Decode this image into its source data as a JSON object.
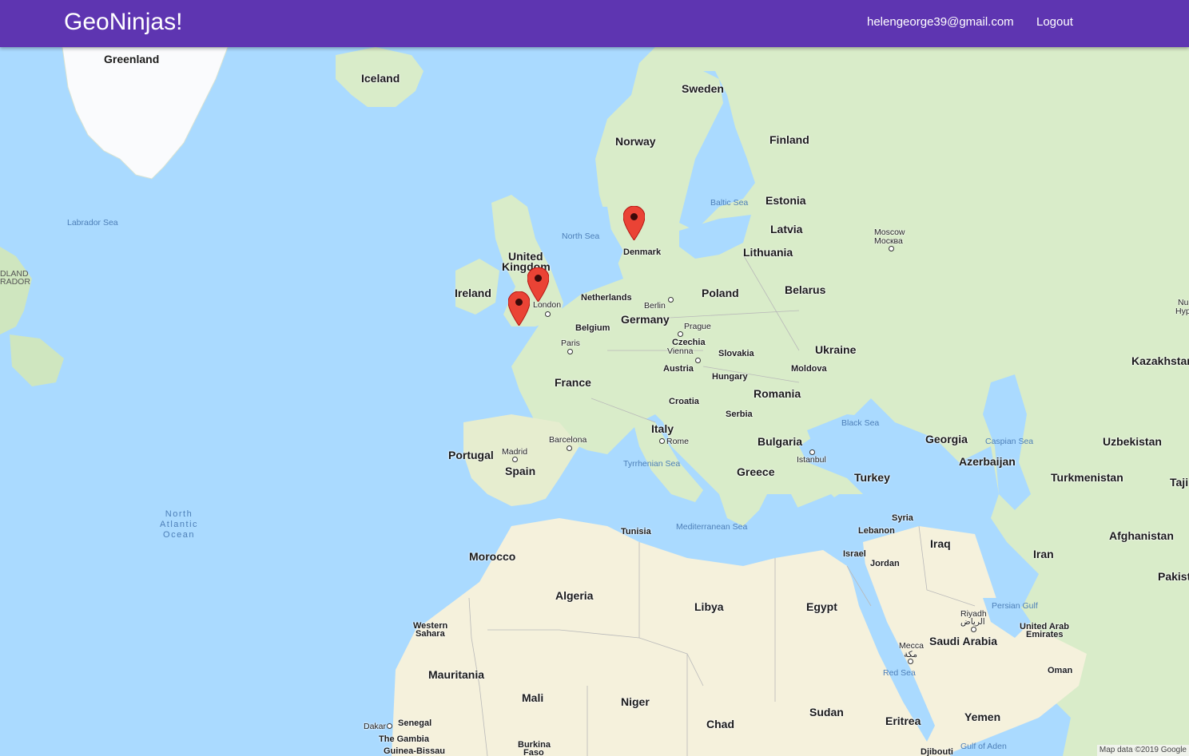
{
  "navbar": {
    "brand": "GeoNinjas!",
    "user_email": "helengeorge39@gmail.com",
    "logout_label": "Logout",
    "color": "#5e35b1"
  },
  "map": {
    "water_color": "#aadaff",
    "land_color": "#d9ecc9",
    "desert_color": "#f5f1dc",
    "ice_color": "#fafbfd",
    "attribution": "Map data ©2019 Google",
    "marker_count": 3,
    "labels": {
      "greenland": "Greenland",
      "iceland": "Iceland",
      "sweden": "Sweden",
      "norway": "Norway",
      "finland": "Finland",
      "estonia": "Estonia",
      "latvia": "Latvia",
      "lithuania": "Lithuania",
      "belarus": "Belarus",
      "denmark": "Denmark",
      "uk_line1": "United",
      "uk_line2": "Kingdom",
      "ireland": "Ireland",
      "netherlands": "Netherlands",
      "belgium": "Belgium",
      "germany": "Germany",
      "poland": "Poland",
      "czechia": "Czechia",
      "slovakia": "Slovakia",
      "austria": "Austria",
      "hungary": "Hungary",
      "ukraine": "Ukraine",
      "moldova": "Moldova",
      "romania": "Romania",
      "france": "France",
      "croatia": "Croatia",
      "serbia": "Serbia",
      "italy": "Italy",
      "bulgaria": "Bulgaria",
      "greece": "Greece",
      "turkey": "Turkey",
      "portugal": "Portugal",
      "spain": "Spain",
      "morocco": "Morocco",
      "algeria": "Algeria",
      "tunisia": "Tunisia",
      "libya": "Libya",
      "egypt": "Egypt",
      "western_sahara_1": "Western",
      "western_sahara_2": "Sahara",
      "mauritania": "Mauritania",
      "mali": "Mali",
      "niger": "Niger",
      "chad": "Chad",
      "sudan": "Sudan",
      "eritrea": "Eritrea",
      "senegal": "Senegal",
      "gambia": "The Gambia",
      "guinea_bissau": "Guinea-Bissau",
      "burkina_1": "Burkina",
      "burkina_2": "Faso",
      "djibouti": "Djibouti",
      "yemen": "Yemen",
      "oman": "Oman",
      "uae_1": "United Arab",
      "uae_2": "Emirates",
      "saudi": "Saudi Arabia",
      "iraq": "Iraq",
      "iran": "Iran",
      "syria": "Syria",
      "lebanon": "Lebanon",
      "israel": "Israel",
      "jordan": "Jordan",
      "georgia": "Georgia",
      "azerbaijan": "Azerbaijan",
      "turkmenistan": "Turkmenistan",
      "uzbekistan": "Uzbekistan",
      "kazakhstan": "Kazakhstan",
      "afghanistan": "Afghanistan",
      "pakistan": "Pakist",
      "tajik": "Taji",
      "nu": "Nu",
      "hyp": "Hyp",
      "dland": "DLAND",
      "rador": "RADOR"
    },
    "cities": {
      "moscow_1": "Moscow",
      "moscow_2": "Москва",
      "london": "London",
      "berlin": "Berlin",
      "prague": "Prague",
      "paris": "Paris",
      "vienna": "Vienna",
      "barcelona": "Barcelona",
      "madrid": "Madrid",
      "rome": "Rome",
      "istanbul": "Istanbul",
      "riyadh_1": "Riyadh",
      "riyadh_2": "الرياض",
      "mecca_1": "Mecca",
      "mecca_2": "مكة",
      "dakar": "Dakar"
    },
    "seas": {
      "labrador": "Labrador Sea",
      "north_sea": "North Sea",
      "baltic": "Baltic Sea",
      "black_sea": "Black Sea",
      "caspian": "Caspian Sea",
      "tyrrhenian": "Tyrrhenian Sea",
      "mediterranean": "Mediterranean Sea",
      "persian_gulf": "Persian Gulf",
      "red_sea": "Red Sea",
      "gulf_aden": "Gulf of Aden",
      "atlantic": "North\nAtlantic\nOcean"
    }
  }
}
